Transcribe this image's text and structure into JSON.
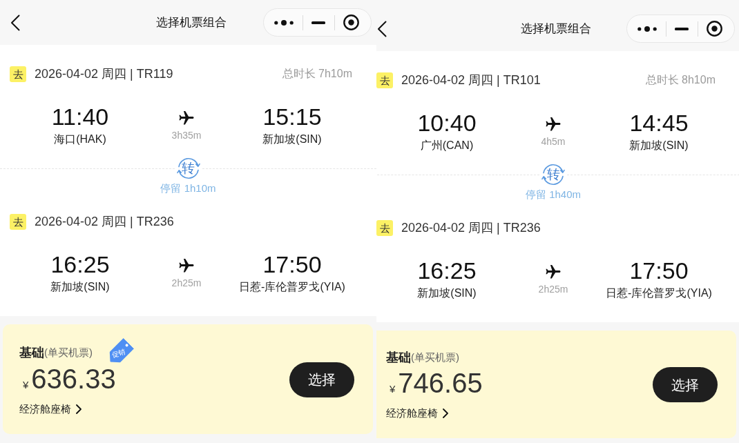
{
  "screens": [
    {
      "header": {
        "title": "选择机票组合"
      },
      "legs": [
        {
          "kind": "flight",
          "tag": "去",
          "info": "2026-04-02 周四 | TR119",
          "total_duration": "总时长 7h10m",
          "depart_time": "11:40",
          "depart_airport": "海口(HAK)",
          "duration": "3h35m",
          "arrive_time": "15:15",
          "arrive_airport": "新加坡(SIN)"
        },
        {
          "kind": "layover",
          "badge": "转",
          "text": "停留 1h10m"
        },
        {
          "kind": "flight",
          "tag": "去",
          "info": "2026-04-02 周四 | TR236",
          "depart_time": "16:25",
          "depart_airport": "新加坡(SIN)",
          "duration": "2h25m",
          "arrive_time": "17:50",
          "arrive_airport": "日惹-库伦普罗戈(YIA)"
        }
      ],
      "fare": {
        "name": "基础",
        "note": "(单买机票)",
        "promo_tag": "促销",
        "currency": "¥",
        "price": "636.33",
        "cabin": "经济舱座椅",
        "button": "选择"
      }
    },
    {
      "header": {
        "title": "选择机票组合"
      },
      "legs": [
        {
          "kind": "flight",
          "tag": "去",
          "info": "2026-04-02 周四 | TR101",
          "total_duration": "总时长 8h10m",
          "depart_time": "10:40",
          "depart_airport": "广州(CAN)",
          "duration": "4h5m",
          "arrive_time": "14:45",
          "arrive_airport": "新加坡(SIN)"
        },
        {
          "kind": "layover",
          "badge": "转",
          "text": "停留 1h40m"
        },
        {
          "kind": "flight",
          "tag": "去",
          "info": "2026-04-02 周四 | TR236",
          "depart_time": "16:25",
          "depart_airport": "新加坡(SIN)",
          "duration": "2h25m",
          "arrive_time": "17:50",
          "arrive_airport": "日惹-库伦普罗戈(YIA)"
        }
      ],
      "fare": {
        "name": "基础",
        "note": "(单买机票)",
        "currency": "¥",
        "price": "746.65",
        "cabin": "经济舱座椅",
        "button": "选择"
      }
    }
  ]
}
